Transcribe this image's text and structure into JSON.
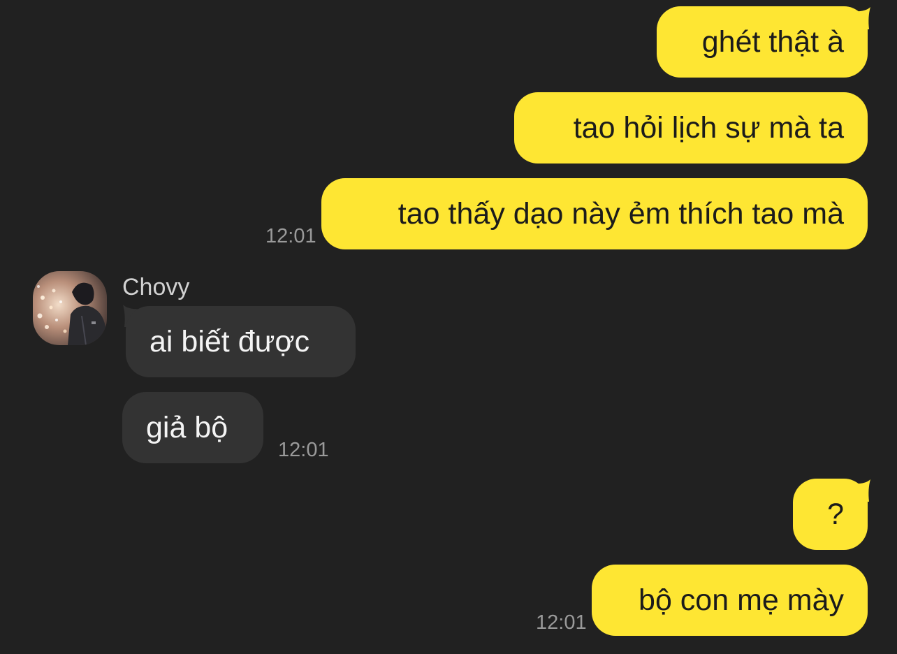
{
  "conversation": {
    "contact": {
      "name": "Chovy",
      "avatar_icon": "avatar-photo-icon"
    },
    "messages": [
      {
        "direction": "outgoing",
        "text": "ghét thật à"
      },
      {
        "direction": "outgoing",
        "text": "tao hỏi lịch sự mà ta"
      },
      {
        "direction": "outgoing",
        "text": "tao thấy dạo này ẻm thích tao mà",
        "time": "12:01"
      },
      {
        "direction": "incoming",
        "text": "ai biết được"
      },
      {
        "direction": "incoming",
        "text": "giả bộ",
        "time": "12:01"
      },
      {
        "direction": "outgoing",
        "text": "?"
      },
      {
        "direction": "outgoing",
        "text": "bộ con mẹ mày",
        "time": "12:01"
      }
    ]
  },
  "colors": {
    "background": "#212121",
    "outgoing_bubble": "#fee633",
    "incoming_bubble": "#333333",
    "timestamp": "#9a9a9a"
  }
}
